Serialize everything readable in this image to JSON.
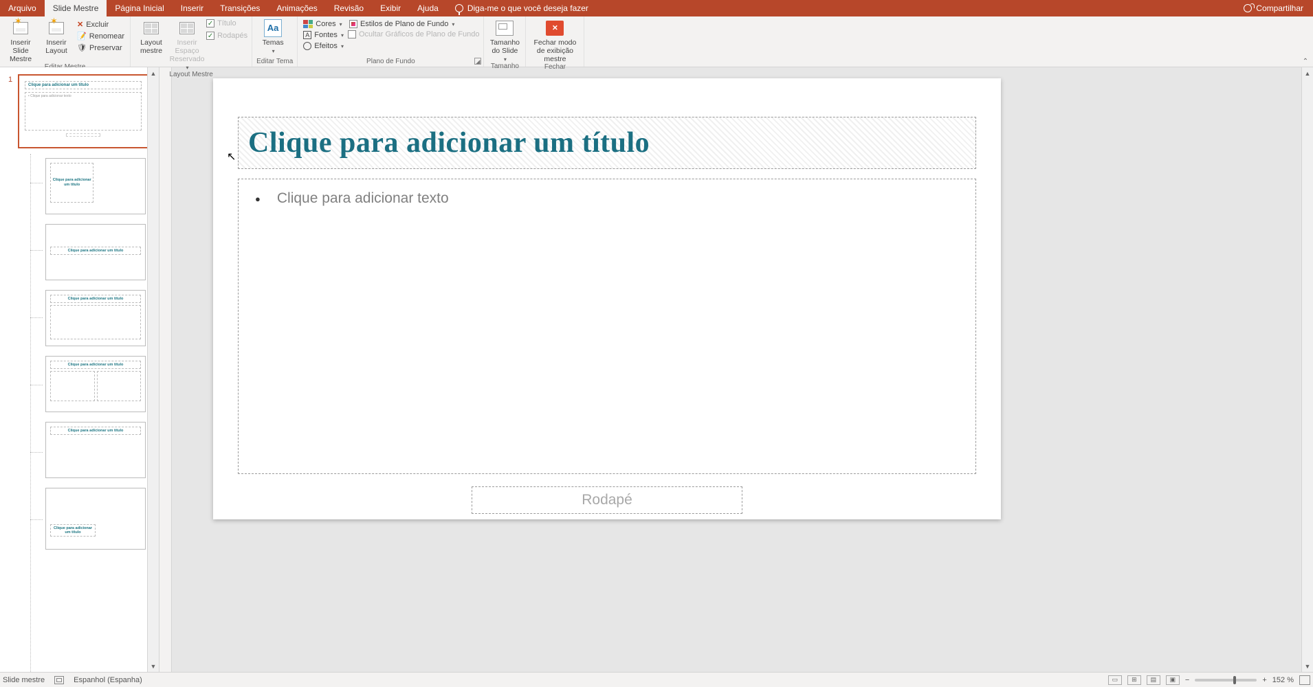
{
  "tabs": {
    "arquivo": "Arquivo",
    "slide_mestre": "Slide Mestre",
    "pagina_inicial": "Página Inicial",
    "inserir": "Inserir",
    "transicoes": "Transições",
    "animacoes": "Animações",
    "revisao": "Revisão",
    "exibir": "Exibir",
    "ajuda": "Ajuda",
    "tellme": "Diga-me o que você deseja fazer",
    "compartilhar": "Compartilhar"
  },
  "ribbon": {
    "editar_mestre": {
      "title": "Editar Mestre",
      "inserir_slide_mestre": "Inserir Slide Mestre",
      "inserir_layout": "Inserir Layout",
      "excluir": "Excluir",
      "renomear": "Renomear",
      "preservar": "Preservar"
    },
    "layout_mestre": {
      "title": "Layout Mestre",
      "layout_mestre_btn": "Layout mestre",
      "inserir_espaco": "Inserir Espaço Reservado",
      "titulo": "Título",
      "rodapes": "Rodapés"
    },
    "editar_tema": {
      "title": "Editar Tema",
      "temas": "Temas"
    },
    "plano_fundo": {
      "title": "Plano de Fundo",
      "cores": "Cores",
      "fontes": "Fontes",
      "efeitos": "Efeitos",
      "estilos_bg": "Estilos de Plano de Fundo",
      "ocultar_graficos": "Ocultar Gráficos de Plano de Fundo"
    },
    "tamanho": {
      "title": "Tamanho",
      "tamanho_slide": "Tamanho do Slide"
    },
    "fechar": {
      "title": "Fechar",
      "fechar_modo": "Fechar modo de exibição mestre"
    }
  },
  "slide": {
    "title_placeholder": "Clique para adicionar um título",
    "body_placeholder": "Clique para adicionar texto",
    "footer_placeholder": "Rodapé"
  },
  "thumbs": {
    "master_index": "1",
    "master_title": "Clique para adicionar um título",
    "layout1_title": "Clique para adicionar um título",
    "layout2_title": "Clique para adicionar um título",
    "layout3_title": "Clique para adicionar um título",
    "layout4_title": "Clique para adicionar um título",
    "layout5_title": "Clique para adicionar um título",
    "layout6_title": "Clique para adicionar um título"
  },
  "status": {
    "slide_mestre": "Slide mestre",
    "language": "Espanhol (Espanha)",
    "zoom": "152 %",
    "minus": "−",
    "plus": "+"
  }
}
